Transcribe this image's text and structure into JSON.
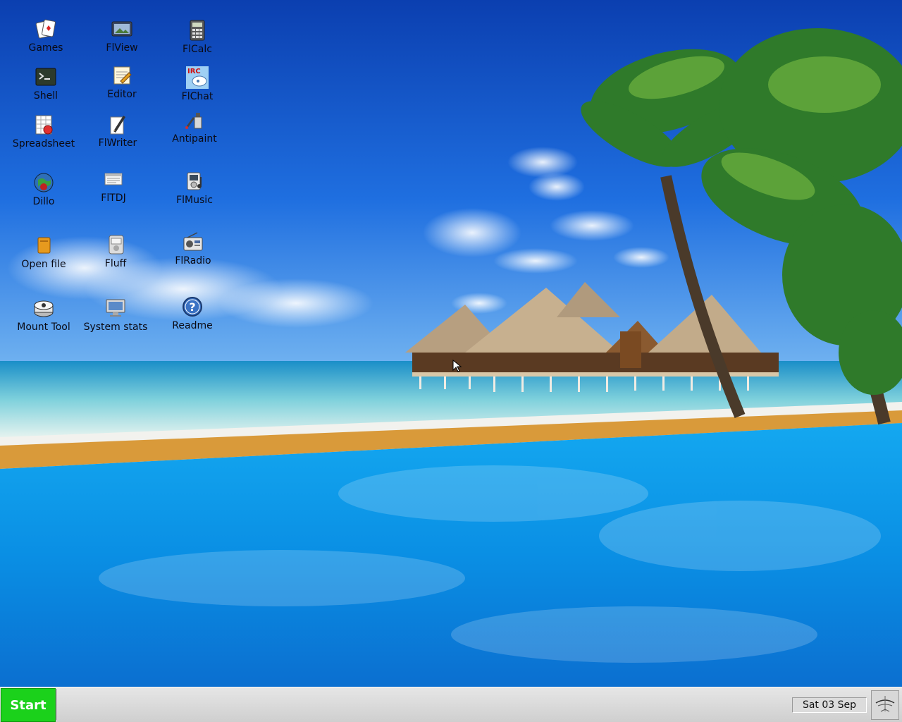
{
  "desktop": {
    "icons": [
      {
        "label": "Games",
        "icon": "cards-icon"
      },
      {
        "label": "FlView",
        "icon": "image-viewer-icon"
      },
      {
        "label": "FlCalc",
        "icon": "calculator-icon"
      },
      {
        "label": "Shell",
        "icon": "terminal-icon"
      },
      {
        "label": "Editor",
        "icon": "notepad-icon"
      },
      {
        "label": "FlChat",
        "icon": "irc-chat-icon"
      },
      {
        "label": "Spreadsheet",
        "icon": "spreadsheet-icon"
      },
      {
        "label": "FlWriter",
        "icon": "pen-paper-icon"
      },
      {
        "label": "Antipaint",
        "icon": "paint-icon"
      },
      {
        "label": "Dillo",
        "icon": "globe-icon"
      },
      {
        "label": "FlTDJ",
        "icon": "planner-icon"
      },
      {
        "label": "FlMusic",
        "icon": "music-player-icon"
      },
      {
        "label": "Open file",
        "icon": "file-icon"
      },
      {
        "label": "Fluff",
        "icon": "file-manager-icon"
      },
      {
        "label": "FlRadio",
        "icon": "radio-icon"
      },
      {
        "label": "Mount Tool",
        "icon": "disk-icon"
      },
      {
        "label": "System stats",
        "icon": "monitor-icon"
      },
      {
        "label": "Readme",
        "icon": "help-icon"
      }
    ]
  },
  "taskbar": {
    "start_label": "Start",
    "clock": "Sat 03 Sep",
    "tray_icon": "tray-menu-icon"
  },
  "colors": {
    "start_green": "#1bd11b",
    "taskbar_gray": "#d6d6d6",
    "sky_blue": "#1a5fd0",
    "pool_blue": "#0a9bea"
  }
}
